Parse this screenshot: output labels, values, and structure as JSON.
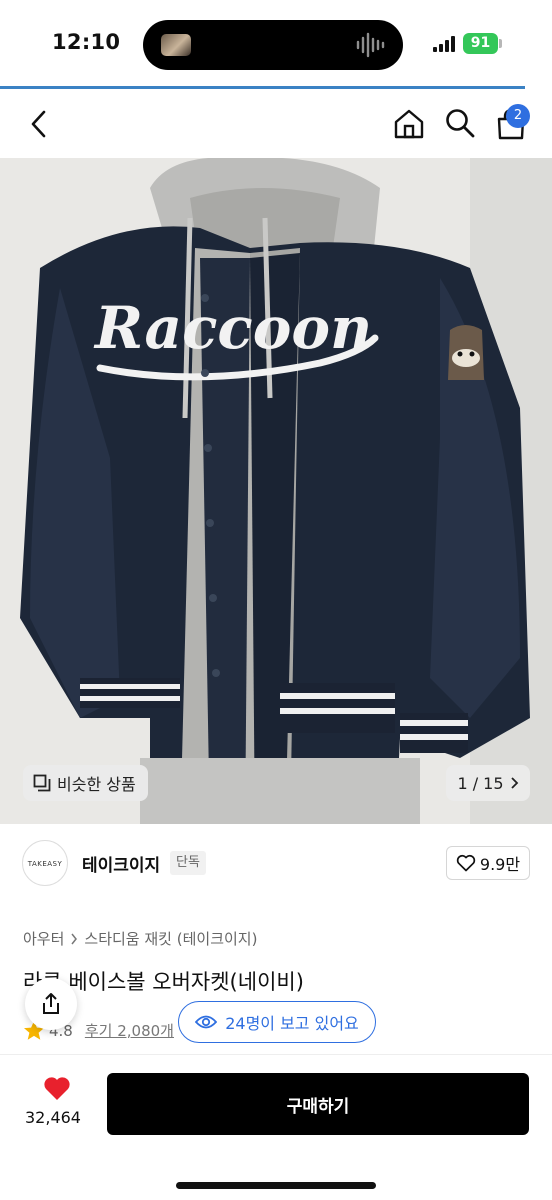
{
  "status_bar": {
    "time": "12:10",
    "battery": "91"
  },
  "nav": {
    "icons": [
      "back-icon",
      "home-icon",
      "search-icon",
      "cart-icon"
    ],
    "cart_count": "2"
  },
  "product_image": {
    "similar_label": "비슷한 상품",
    "page_indicator": "1 / 15",
    "jacket_lettering": "Raccoon"
  },
  "brand": {
    "logo_text": "TAKEASY",
    "name": "테이크이지",
    "badge": "단독",
    "likes": "9.9만"
  },
  "breadcrumb": {
    "items": [
      "아우터",
      "스타디움 재킷 (테이크이지)"
    ]
  },
  "product": {
    "title": "라쿤 베이스볼 오버자켓(네이비)",
    "rating": "4.8",
    "reviews": "후기 2,080개"
  },
  "viewers": {
    "label": "24명이 보고 있어요"
  },
  "bottom_bar": {
    "like_count": "32,464",
    "buy_label": "구매하기"
  },
  "colors": {
    "accent": "#2f6fe0",
    "buy_button": "#000000",
    "heart": "#e8212d",
    "battery": "#34c759"
  }
}
